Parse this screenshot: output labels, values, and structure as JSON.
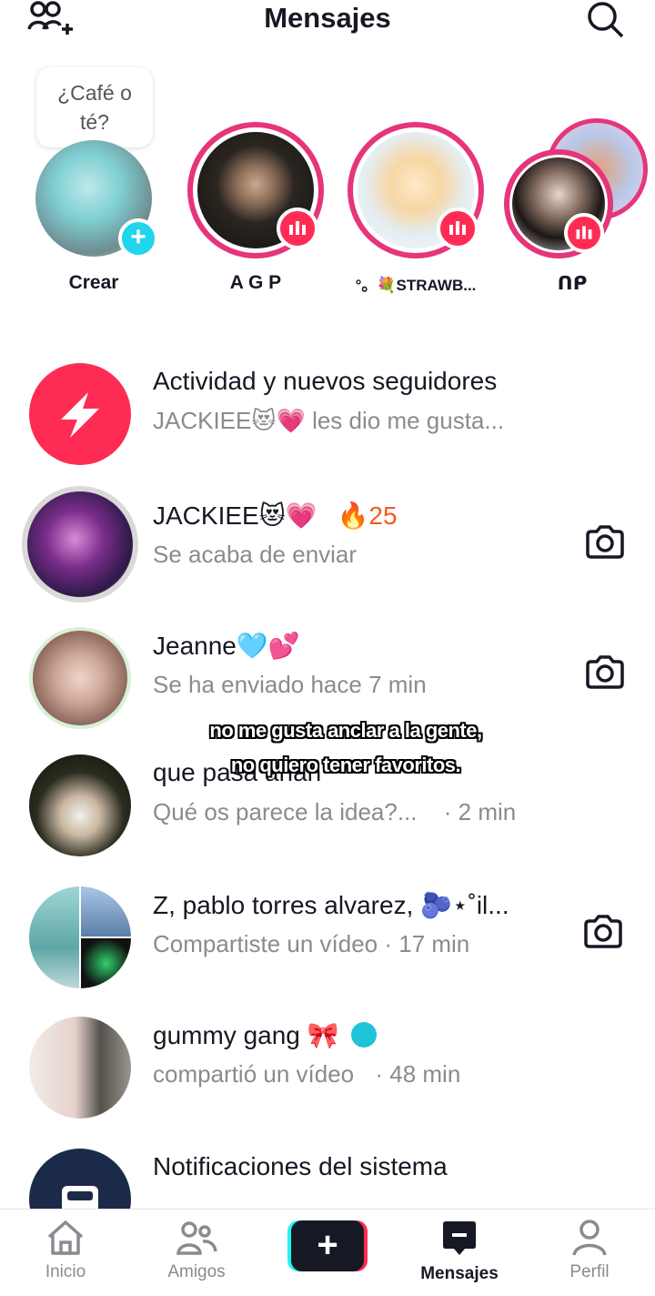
{
  "header": {
    "title": "Mensajes"
  },
  "stories": {
    "bubble": {
      "line1": "¿Café o",
      "line2": "té?"
    },
    "items": [
      {
        "label": "Crear"
      },
      {
        "label": "A G P"
      },
      {
        "label": "°。💐STRAWB..."
      },
      {
        "label": "ᑎᑭ"
      }
    ]
  },
  "conversations": [
    {
      "name": "Actividad y nuevos seguidores",
      "sub": "JACKIEE😻💗 les dio me gusta..."
    },
    {
      "name": "JACKIEE😻💗",
      "streak": "🔥25",
      "sub": "Se acaba de enviar"
    },
    {
      "name": "Jeanne🩵💕",
      "sub": "Se ha enviado hace 7 min"
    },
    {
      "name": "que pasa arlan",
      "sub": "Qué os parece la idea?...",
      "time": "· 2 min"
    },
    {
      "name": "Z, pablo torres alvarez, 🫐⋆˚il...",
      "sub": "Compartiste un vídeo · 17 min"
    },
    {
      "name": "gummy gang 🎀",
      "sub": "compartió un vídeo",
      "time": "· 48 min"
    },
    {
      "name": "Notificaciones del sistema",
      "sub": ""
    }
  ],
  "overlay": {
    "caption": "no me gusta anclar a la gente, no quiero tener favoritos."
  },
  "nav": {
    "home": "Inicio",
    "friends": "Amigos",
    "messages": "Mensajes",
    "profile": "Perfil"
  },
  "colors": {
    "accent": "#fe2c55",
    "ring": "#e6357b",
    "text": "#161823",
    "muted": "#8a8b91"
  }
}
